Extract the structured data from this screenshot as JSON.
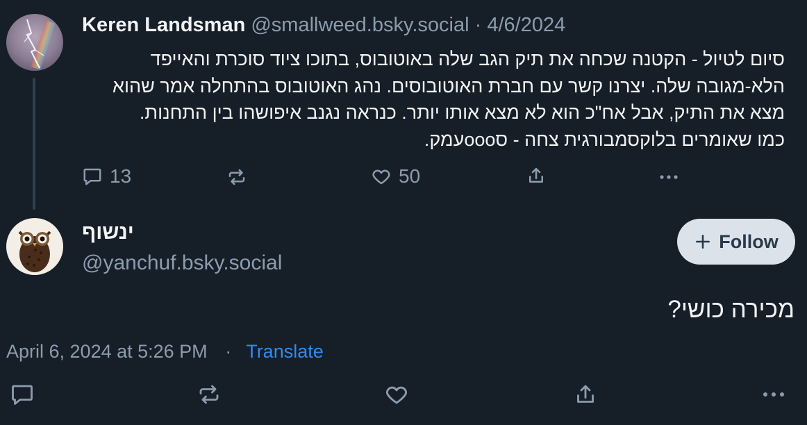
{
  "parent_post": {
    "author_name": "Keren Landsman",
    "handle": "@smallweed.bsky.social",
    "separator": "·",
    "date": "4/6/2024",
    "text_lines": [
      "סיום לטיול - הקטנה שכחה את תיק הגב שלה באוטובוס, בתוכו ציוד סוכרת והאייפד",
      "הלא-מגובה שלה. יצרנו קשר עם חברת האוטובוסים. נהג האוטובוס בהתחלה אמר שהוא",
      "מצא את התיק, אבל אח\"כ הוא לא מצא אותו יותר. כנראה נגנב איפושהו בין התחנות.",
      "כמו שאומרים בלוקסמבורגית צחה - סoooעמק."
    ],
    "reply_count": "13",
    "like_count": "50"
  },
  "reply_post": {
    "author_name": "ינשוף",
    "handle": "@yanchuf.bsky.social",
    "follow_label": "Follow",
    "text": "מכירה כושי?",
    "timestamp": "April 6, 2024 at 5:26 PM",
    "separator": "·",
    "translate_label": "Translate"
  },
  "colors": {
    "background": "#161e27",
    "text": "#f1f3f5",
    "muted": "#8c9cae",
    "link": "#2f8cf2",
    "follow_button_bg": "#dbe2ea"
  },
  "icons": [
    "comment-icon",
    "repost-icon",
    "heart-icon",
    "share-icon",
    "more-icon",
    "plus-icon"
  ]
}
